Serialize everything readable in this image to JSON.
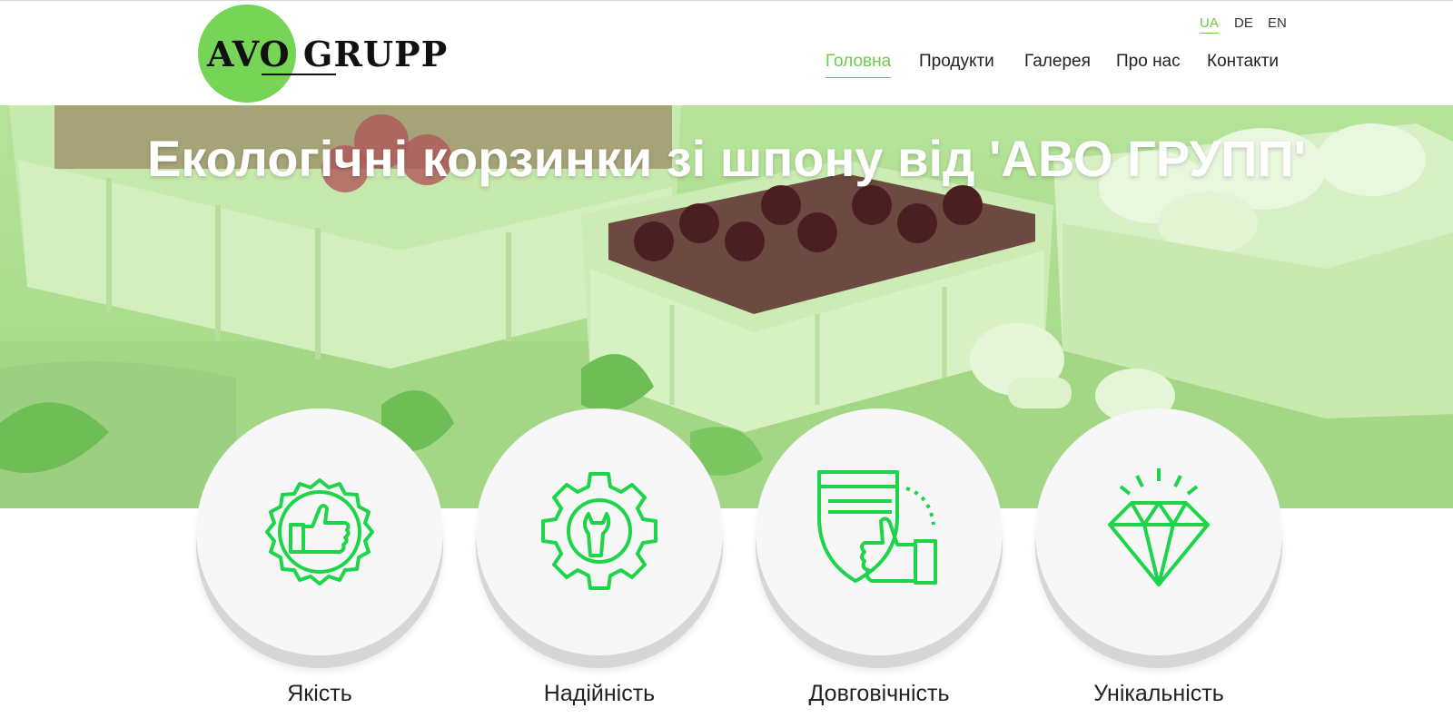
{
  "logo": {
    "text_left": "AVO",
    "text_right": "GRUPP"
  },
  "languages": [
    {
      "code": "UA",
      "active": true
    },
    {
      "code": "DE",
      "active": false
    },
    {
      "code": "EN",
      "active": false
    }
  ],
  "nav": [
    {
      "label": "Головна",
      "active": true
    },
    {
      "label": "Продукти",
      "active": false
    },
    {
      "label": "Галерея",
      "active": false
    },
    {
      "label": "Про нас",
      "active": false
    },
    {
      "label": "Контакти",
      "active": false
    }
  ],
  "hero": {
    "title": "Екологічні корзинки зі шпону від 'АВО ГРУПП'"
  },
  "features": [
    {
      "label": "Якість",
      "icon": "thumbs-up-badge-icon"
    },
    {
      "label": "Надійність",
      "icon": "gear-wrench-icon"
    },
    {
      "label": "Довговічність",
      "icon": "shield-thumbs-up-icon"
    },
    {
      "label": "Унікальність",
      "icon": "diamond-icon"
    }
  ],
  "colors": {
    "accent": "#6bcb4a",
    "logo_circle": "#76d456",
    "icon": "#1ed44a",
    "hero_overlay": "#a9dc8c"
  }
}
